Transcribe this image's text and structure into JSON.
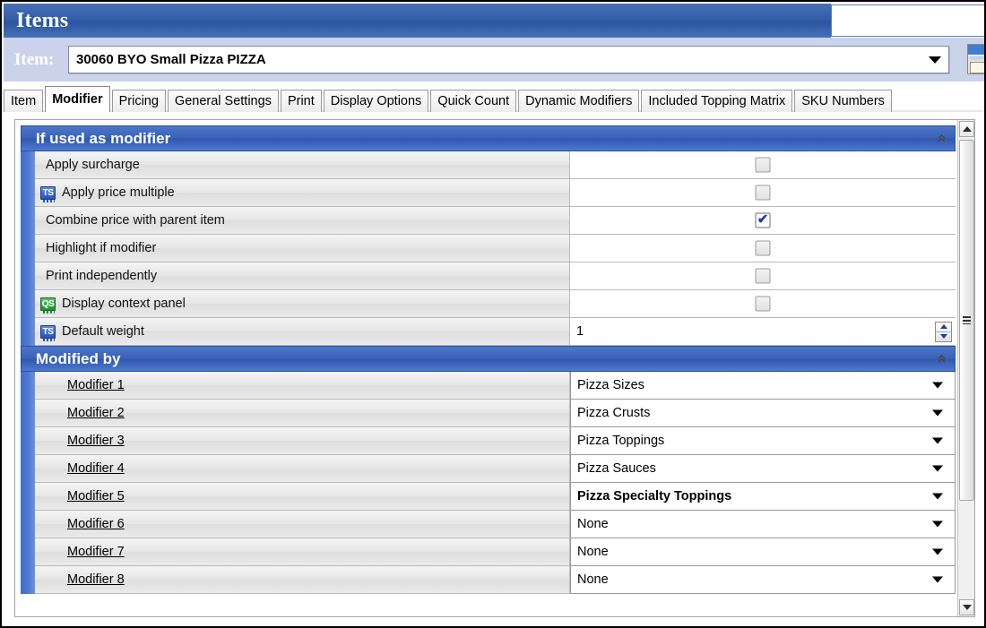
{
  "window": {
    "title": "Items"
  },
  "item_selector": {
    "label": "Item:",
    "value": "30060 BYO Small Pizza PIZZA",
    "dropdown_icon": "chevron-down-icon",
    "side_button_icon": "form-window-icon"
  },
  "tabs": [
    {
      "label": "Item",
      "active": false
    },
    {
      "label": "Modifier",
      "active": true
    },
    {
      "label": "Pricing",
      "active": false
    },
    {
      "label": "General Settings",
      "active": false
    },
    {
      "label": "Print",
      "active": false
    },
    {
      "label": "Display Options",
      "active": false
    },
    {
      "label": "Quick Count",
      "active": false
    },
    {
      "label": "Dynamic Modifiers",
      "active": false
    },
    {
      "label": "Included Topping Matrix",
      "active": false
    },
    {
      "label": "SKU Numbers",
      "active": false
    }
  ],
  "sections": [
    {
      "title": "If used as modifier",
      "collapse_icon": "double-chevron-up-icon",
      "rows": [
        {
          "label": "Apply surcharge",
          "icon": null,
          "control": "checkbox",
          "checked": false
        },
        {
          "label": "Apply price multiple",
          "icon": "ts-badge-icon",
          "control": "checkbox",
          "checked": false
        },
        {
          "label": "Combine price with parent item",
          "icon": null,
          "control": "checkbox",
          "checked": true
        },
        {
          "label": "Highlight if modifier",
          "icon": null,
          "control": "checkbox",
          "checked": false
        },
        {
          "label": "Print independently",
          "icon": null,
          "control": "checkbox",
          "checked": false
        },
        {
          "label": "Display context panel",
          "icon": "qs-badge-icon",
          "control": "checkbox",
          "checked": false
        },
        {
          "label": "Default weight",
          "icon": "ts-badge-icon",
          "control": "number",
          "value": "1"
        }
      ]
    },
    {
      "title": "Modified by",
      "collapse_icon": "double-chevron-up-icon",
      "rows": [
        {
          "label": "Modifier 1",
          "control": "combobox",
          "value": "Pizza Sizes",
          "bold": false
        },
        {
          "label": "Modifier 2",
          "control": "combobox",
          "value": "Pizza Crusts",
          "bold": false
        },
        {
          "label": "Modifier 3",
          "control": "combobox",
          "value": "Pizza Toppings",
          "bold": false
        },
        {
          "label": "Modifier 4",
          "control": "combobox",
          "value": "Pizza Sauces",
          "bold": false
        },
        {
          "label": "Modifier 5",
          "control": "combobox",
          "value": "Pizza Specialty Toppings",
          "bold": true
        },
        {
          "label": "Modifier 6",
          "control": "combobox",
          "value": "None",
          "bold": false
        },
        {
          "label": "Modifier 7",
          "control": "combobox",
          "value": "None",
          "bold": false
        },
        {
          "label": "Modifier 8",
          "control": "combobox",
          "value": "None",
          "bold": false
        }
      ]
    }
  ],
  "badges": {
    "ts": "TS",
    "qs": "QS"
  },
  "scrollbar": {
    "up_icon": "scroll-up-arrow-icon",
    "down_icon": "scroll-down-arrow-icon",
    "thumb_icon": "scroll-thumb-grip-icon"
  },
  "colors": {
    "titlebar_blue": "#325fa8",
    "section_header_blue": "#3a62b8",
    "strip_lavender": "#cbd3ea",
    "row_gray": "#e6e6e6",
    "check_blue": "#1f3f9e"
  }
}
